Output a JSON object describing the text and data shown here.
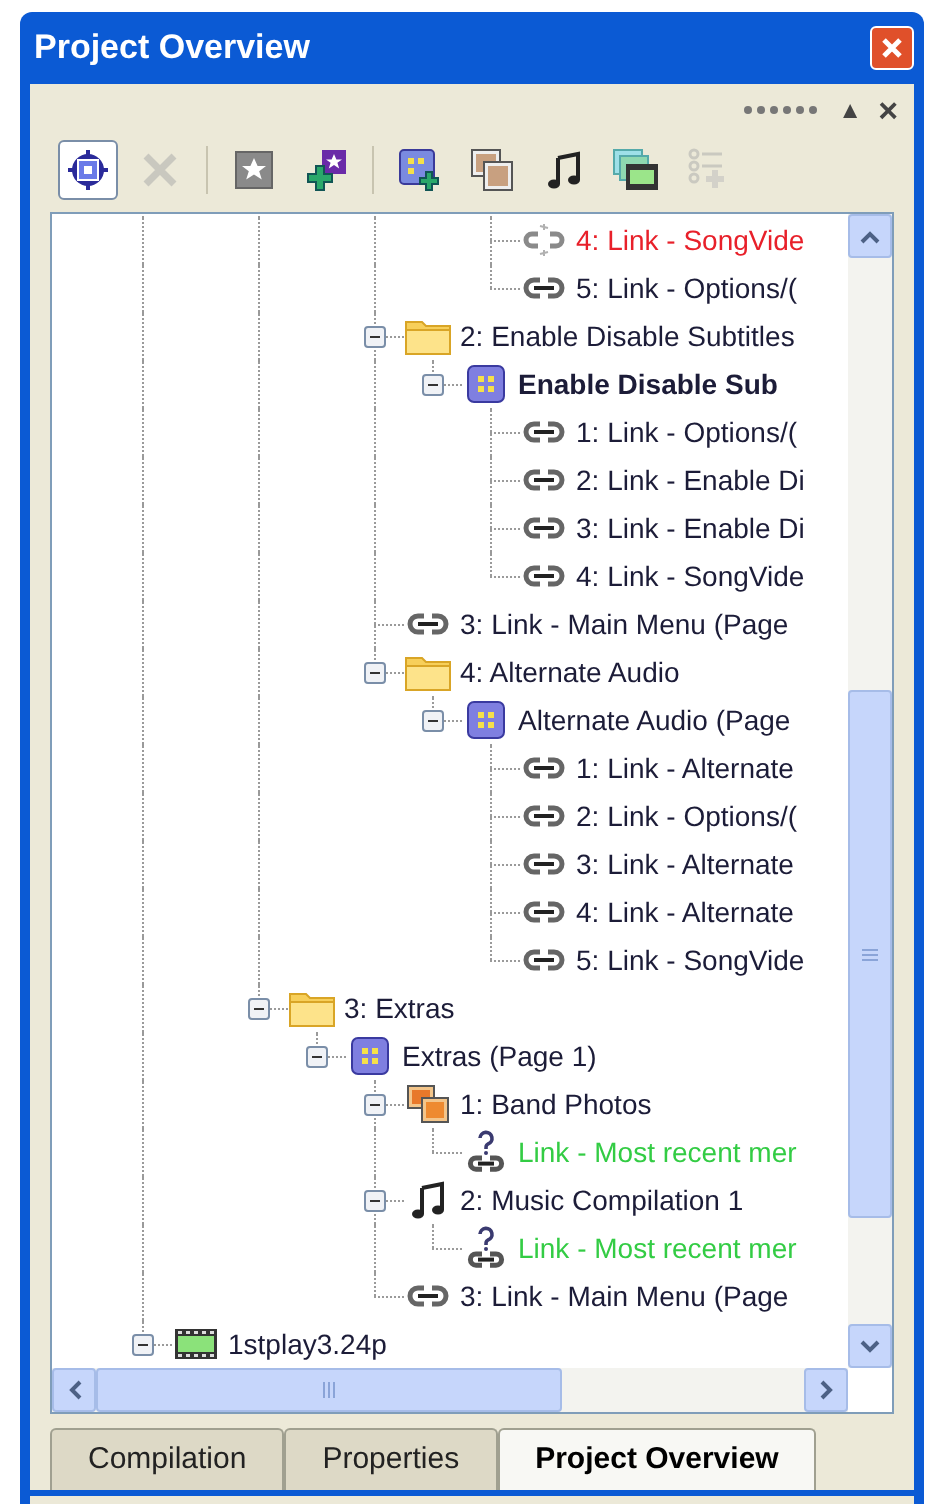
{
  "window": {
    "title": "Project Overview"
  },
  "panel_controls": {
    "collapse": "▲",
    "close": "×"
  },
  "toolbar": [
    {
      "kind": "target",
      "selected": true,
      "disabled": false
    },
    {
      "kind": "delete",
      "selected": false,
      "disabled": true
    },
    {
      "kind": "separator"
    },
    {
      "kind": "star",
      "selected": false,
      "disabled": false
    },
    {
      "kind": "add-star",
      "selected": false,
      "disabled": false
    },
    {
      "kind": "separator"
    },
    {
      "kind": "add-page",
      "selected": false,
      "disabled": false
    },
    {
      "kind": "slideshow",
      "selected": false,
      "disabled": false
    },
    {
      "kind": "music",
      "selected": false,
      "disabled": false
    },
    {
      "kind": "timeline",
      "selected": false,
      "disabled": false
    },
    {
      "kind": "add-list",
      "selected": false,
      "disabled": true
    }
  ],
  "tree": [
    {
      "children": [
        {
          "children": [
            {
              "children": [
                {
                  "children": [
                    {
                      "children": [
                        {
                          "children": [
                            {
                              "kind": "broken-link",
                              "label": "4: Link - SongVide",
                              "active": false
                            },
                            {
                              "kind": "link",
                              "label": "5: Link - Options/(",
                              "active": false
                            }
                          ]
                        }
                      ]
                    },
                    {
                      "kind": "folder",
                      "label": "2: Enable Disable Subtitles",
                      "active": false,
                      "expanded": true,
                      "children": [
                        {
                          "kind": "page",
                          "label": "Enable Disable Sub",
                          "active": true,
                          "expanded": true,
                          "children": [
                            {
                              "kind": "link",
                              "label": "1: Link - Options/(",
                              "active": false
                            },
                            {
                              "kind": "link",
                              "label": "2: Link - Enable Di",
                              "active": false
                            },
                            {
                              "kind": "link",
                              "label": "3: Link - Enable Di",
                              "active": false
                            },
                            {
                              "kind": "link",
                              "label": "4: Link - SongVide",
                              "active": false
                            }
                          ]
                        }
                      ]
                    },
                    {
                      "kind": "link",
                      "label": "3: Link - Main Menu (Page",
                      "active": false
                    },
                    {
                      "kind": "folder",
                      "label": "4: Alternate Audio",
                      "active": false,
                      "expanded": true,
                      "children": [
                        {
                          "kind": "page",
                          "label": "Alternate Audio (Page",
                          "active": false,
                          "expanded": true,
                          "children": [
                            {
                              "kind": "link",
                              "label": "1: Link - Alternate",
                              "active": false
                            },
                            {
                              "kind": "link",
                              "label": "2: Link - Options/(",
                              "active": false
                            },
                            {
                              "kind": "link",
                              "label": "3: Link - Alternate",
                              "active": false
                            },
                            {
                              "kind": "link",
                              "label": "4: Link - Alternate",
                              "active": false
                            },
                            {
                              "kind": "link",
                              "label": "5: Link - SongVide",
                              "active": false
                            }
                          ]
                        }
                      ]
                    }
                  ]
                }
              ]
            },
            {
              "kind": "folder",
              "label": "3: Extras",
              "active": false,
              "expanded": true,
              "children": [
                {
                  "kind": "page",
                  "label": "Extras (Page 1)",
                  "active": false,
                  "expanded": true,
                  "children": [
                    {
                      "kind": "slideshow",
                      "label": "1: Band Photos",
                      "active": false,
                      "expanded": true,
                      "children": [
                        {
                          "kind": "unresolved-link",
                          "label": "Link - Most recent mer",
                          "active": false
                        }
                      ]
                    },
                    {
                      "kind": "music",
                      "label": "2: Music Compilation 1",
                      "active": false,
                      "expanded": true,
                      "children": [
                        {
                          "kind": "unresolved-link",
                          "label": "Link - Most recent mer",
                          "active": false
                        }
                      ]
                    },
                    {
                      "kind": "link",
                      "label": "3: Link - Main Menu (Page",
                      "active": false
                    }
                  ]
                }
              ]
            }
          ]
        }
      ]
    },
    {
      "kind": "timeline",
      "label": "1stplay3.24p",
      "active": false,
      "expanded": true
    }
  ],
  "tabs": [
    {
      "label": "Compilation",
      "selected": false
    },
    {
      "label": "Properties",
      "selected": false
    },
    {
      "label": "Project Overview",
      "selected": true
    }
  ]
}
